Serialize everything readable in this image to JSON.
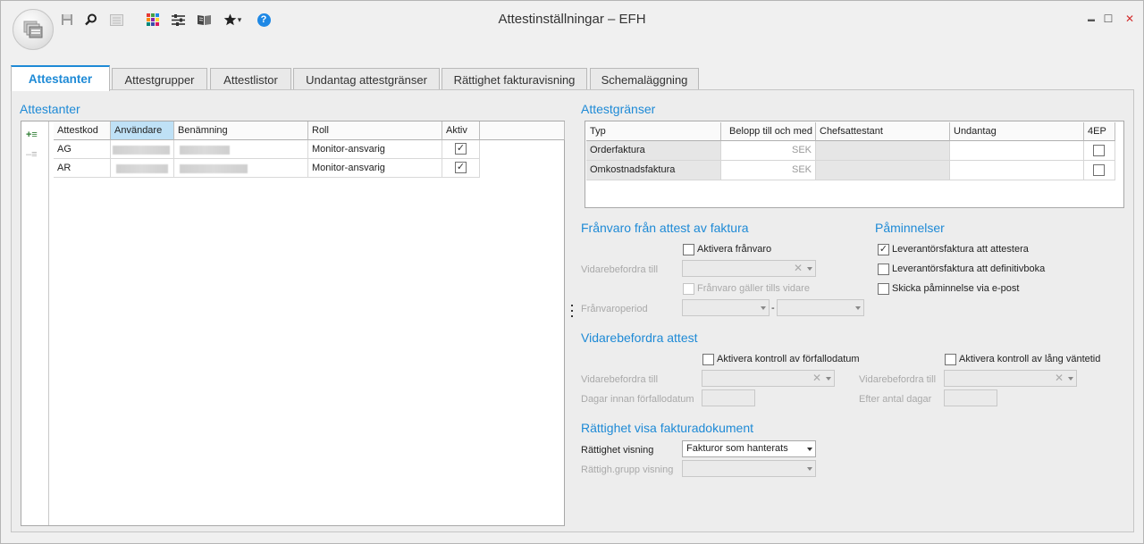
{
  "window": {
    "title": "Attestinställningar – EFH",
    "controls": {
      "minimize": "▬",
      "maximize": "☐",
      "close": "✕"
    }
  },
  "toolbar": {
    "icons": [
      "save-icon",
      "search-icon",
      "list-icon",
      "color-grid-icon",
      "settings-sliders-icon",
      "book-icon",
      "favorites-star-icon",
      "help-icon"
    ],
    "favorites_caret": "▾",
    "help_glyph": "?"
  },
  "tabs": [
    {
      "label": "Attestanter",
      "active": true
    },
    {
      "label": "Attestgrupper",
      "active": false
    },
    {
      "label": "Attestlistor",
      "active": false
    },
    {
      "label": "Undantag attestgränser",
      "active": false
    },
    {
      "label": "Rättighet fakturavisning",
      "active": false
    },
    {
      "label": "Schemaläggning",
      "active": false
    }
  ],
  "attestanter": {
    "title": "Attestanter",
    "add_glyph": "+≡",
    "remove_glyph": "–≡",
    "columns": [
      "Attestkod",
      "Användare",
      "Benämning",
      "Roll",
      "Aktiv"
    ],
    "rows": [
      {
        "code": "AG",
        "role": "Monitor-ansvarig",
        "active": true
      },
      {
        "code": "AR",
        "role": "Monitor-ansvarig",
        "active": true
      }
    ]
  },
  "attestgranser": {
    "title": "Attestgränser",
    "columns": [
      "Typ",
      "Belopp till och med",
      "Chefsattestant",
      "Undantag",
      "4EP"
    ],
    "rows": [
      {
        "typ": "Orderfaktura",
        "currency": "SEK",
        "fourEP": false
      },
      {
        "typ": "Omkostnadsfaktura",
        "currency": "SEK",
        "fourEP": false
      }
    ]
  },
  "franvaro": {
    "title": "Frånvaro från attest av faktura",
    "activate_label": "Aktivera frånvaro",
    "forward_label": "Vidarebefordra till",
    "valid_label": "Frånvaro gäller tills vidare",
    "period_label": "Frånvaroperiod",
    "period_sep": "-",
    "clear_glyph": "✕"
  },
  "paminnelser": {
    "title": "Påminnelser",
    "items": [
      {
        "label": "Leverantörsfaktura att attestera",
        "checked": true
      },
      {
        "label": "Leverantörsfaktura att definitivboka",
        "checked": false
      },
      {
        "label": "Skicka påminnelse via e-post",
        "checked": false
      }
    ]
  },
  "vidarebefordra": {
    "title": "Vidarebefordra attest",
    "due_check": "Aktivera kontroll av förfallodatum",
    "wait_check": "Aktivera kontroll av lång väntetid",
    "forward_left": "Vidarebefordra till",
    "forward_right": "Vidarebefordra till",
    "days_before_due": "Dagar innan förfallodatum",
    "after_days": "Efter antal dagar"
  },
  "rattighet": {
    "title": "Rättighet visa fakturadokument",
    "view_label": "Rättighet visning",
    "view_value": "Fakturor som hanterats",
    "group_label": "Rättigh.grupp visning"
  }
}
